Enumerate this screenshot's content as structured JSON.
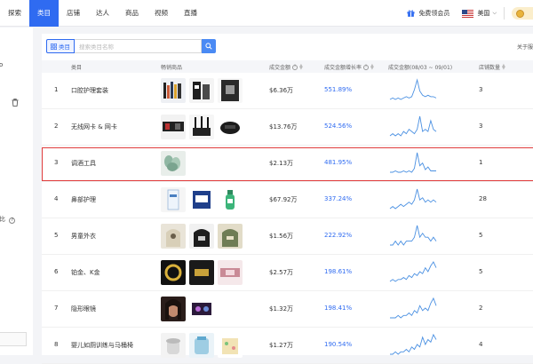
{
  "nav": {
    "items": [
      {
        "label": "探索",
        "active": false
      },
      {
        "label": "类目",
        "active": true
      },
      {
        "label": "店铺",
        "active": false
      },
      {
        "label": "达人",
        "active": false
      },
      {
        "label": "商品",
        "active": false
      },
      {
        "label": "视频",
        "active": false
      },
      {
        "label": "直播",
        "active": false
      }
    ],
    "vip_label": "免费领会员",
    "region_label": "美国",
    "accent": "#2f6bf1"
  },
  "sidebar": {
    "frag_top": "o",
    "frag_mid": "比"
  },
  "search": {
    "category_label": "类目",
    "placeholder": "搜索类目名称"
  },
  "filter_text": "关于服",
  "table": {
    "headers": {
      "category": "类目",
      "products": "畅销商品",
      "amount": "成交金额",
      "growth": "成交金额增长率",
      "trend": "成交金额(08/03 ~ 09/01)",
      "shops": "店铺数量"
    },
    "rows": [
      {
        "rank": "1",
        "name": "口腔护理套装",
        "amount": "$6.36万",
        "growth": "551.89%",
        "shops": "3",
        "trend": [
          2,
          3,
          2,
          3,
          2,
          3,
          4,
          3,
          4,
          9,
          16,
          8,
          5,
          4,
          5,
          4,
          4,
          3
        ]
      },
      {
        "rank": "2",
        "name": "无线网卡 & 网卡",
        "amount": "$13.76万",
        "growth": "524.56%",
        "shops": "3",
        "trend": [
          3,
          4,
          3,
          4,
          3,
          5,
          4,
          6,
          5,
          4,
          6,
          12,
          5,
          6,
          5,
          10,
          6,
          5
        ]
      },
      {
        "rank": "3",
        "name": "调酒工具",
        "amount": "$2.13万",
        "growth": "481.95%",
        "shops": "1",
        "trend": [
          2,
          2,
          3,
          2,
          2,
          3,
          2,
          3,
          2,
          5,
          17,
          7,
          9,
          4,
          6,
          3,
          3,
          3
        ]
      },
      {
        "rank": "4",
        "name": "鼻部护理",
        "amount": "$67.92万",
        "growth": "337.24%",
        "shops": "28",
        "trend": [
          2,
          3,
          2,
          3,
          4,
          3,
          4,
          5,
          4,
          6,
          11,
          6,
          7,
          5,
          6,
          5,
          6,
          5
        ]
      },
      {
        "rank": "5",
        "name": "男童外衣",
        "amount": "$1.56万",
        "growth": "222.92%",
        "shops": "5",
        "trend": [
          2,
          2,
          3,
          2,
          3,
          2,
          3,
          3,
          3,
          4,
          7,
          4,
          5,
          4,
          4,
          3,
          4,
          3
        ]
      },
      {
        "rank": "6",
        "name": "铂金、K金",
        "amount": "$2.57万",
        "growth": "198.61%",
        "shops": "5",
        "trend": [
          2,
          3,
          2,
          3,
          3,
          4,
          3,
          5,
          4,
          6,
          5,
          7,
          6,
          9,
          7,
          10,
          12,
          9
        ]
      },
      {
        "rank": "7",
        "name": "隐形眼镜",
        "amount": "$1.32万",
        "growth": "198.41%",
        "shops": "2",
        "trend": [
          2,
          2,
          2,
          3,
          2,
          3,
          3,
          4,
          3,
          5,
          4,
          7,
          5,
          6,
          5,
          8,
          10,
          7
        ]
      },
      {
        "rank": "8",
        "name": "婴儿如厕训练与马桶椅",
        "amount": "$1.27万",
        "growth": "190.54%",
        "shops": "4",
        "trend": [
          2,
          2,
          3,
          2,
          3,
          3,
          4,
          3,
          5,
          4,
          6,
          5,
          9,
          6,
          8,
          7,
          10,
          8
        ]
      }
    ]
  }
}
